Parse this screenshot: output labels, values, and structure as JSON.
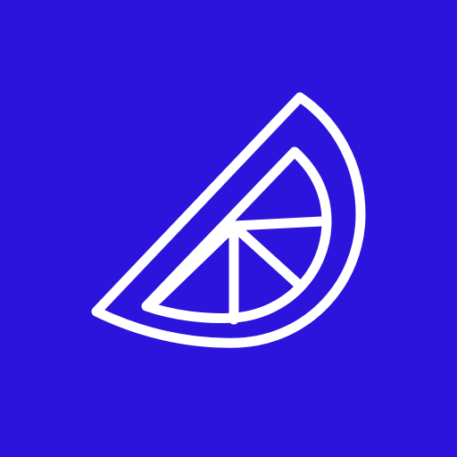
{
  "icon": {
    "name": "lemon-slice-icon",
    "background_color": "#2c14dc",
    "stroke_color": "#ffffff"
  }
}
